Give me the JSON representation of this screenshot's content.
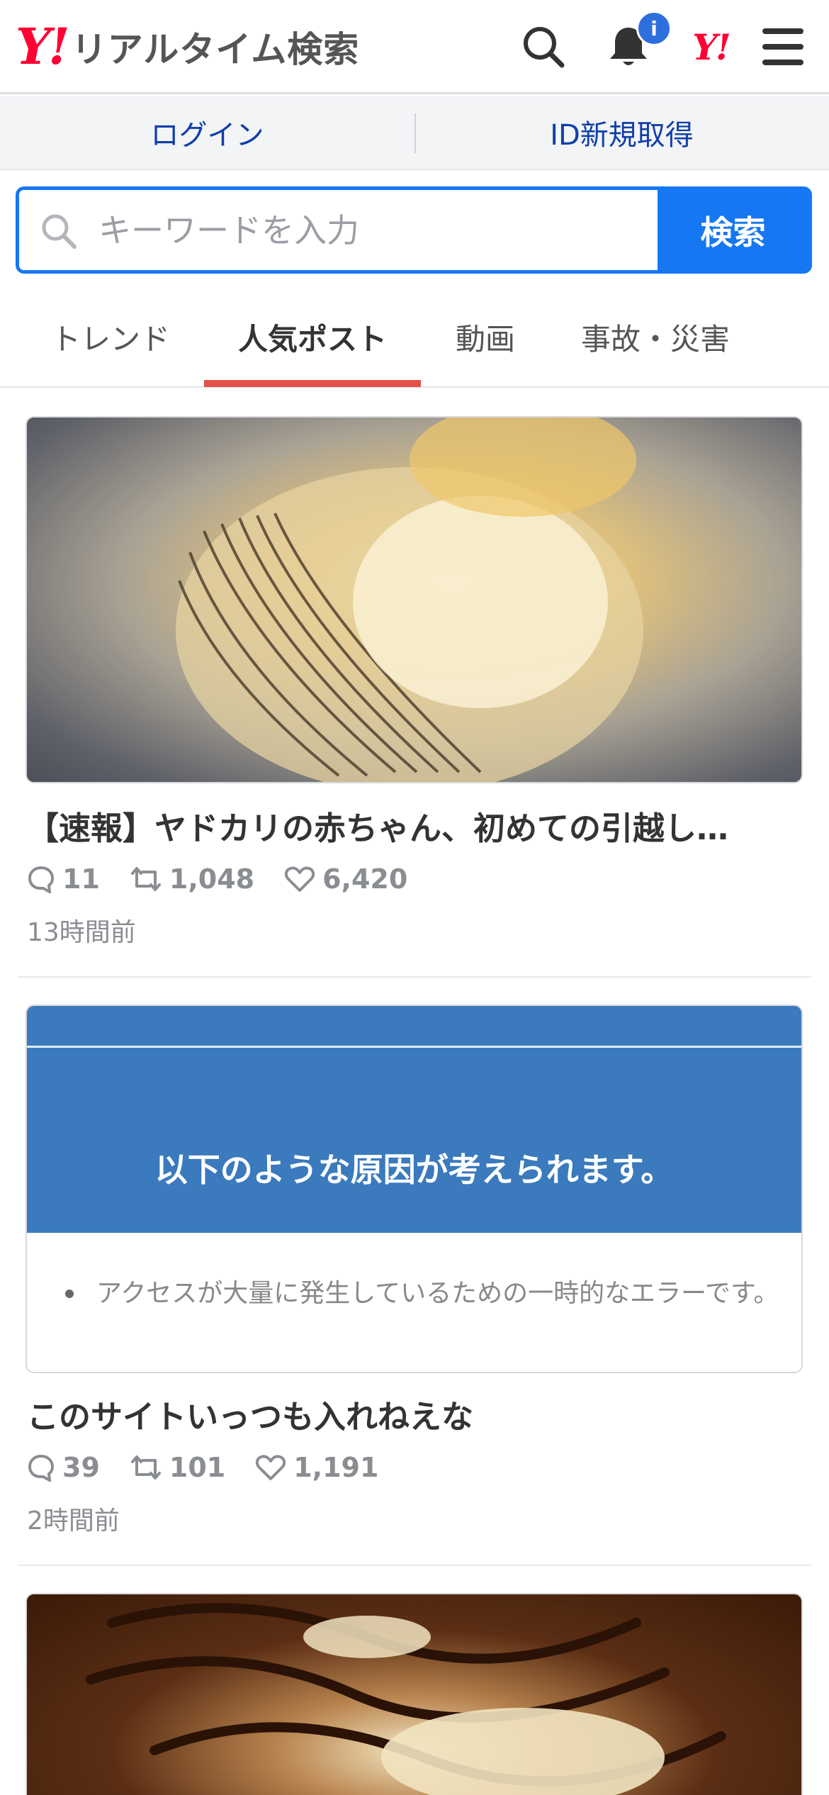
{
  "header": {
    "logo_mark": "Y!",
    "logo_title": "リアルタイム検索",
    "notification_badge": "i",
    "yahoo_logo": "Y!",
    "icons": [
      "search-icon",
      "bell-icon",
      "yahoo-japan-logo",
      "menu-icon"
    ]
  },
  "auth": {
    "login": "ログイン",
    "signup": "ID新規取得"
  },
  "search": {
    "placeholder": "キーワードを入力",
    "button": "検索"
  },
  "tabs": [
    {
      "label": "トレンド",
      "active": false
    },
    {
      "label": "人気ポスト",
      "active": true
    },
    {
      "label": "動画",
      "active": false
    },
    {
      "label": "事故・災害",
      "active": false
    }
  ],
  "colors": {
    "accent_blue": "#1677f2",
    "link_blue": "#1040a8",
    "brand_red": "#ff0033",
    "tab_underline": "#e3514a"
  },
  "posts": [
    {
      "title": "【速報】ヤドカリの赤ちゃん、初めての引越し…",
      "replies": "11",
      "reposts": "1,048",
      "likes": "6,420",
      "time": "13時間前"
    },
    {
      "media_heading": "以下のような原因が考えられます。",
      "media_bullet": "アクセスが大量に発生しているための一時的なエラーです。",
      "title": "このサイトいっつも入れねえな",
      "replies": "39",
      "reposts": "101",
      "likes": "1,191",
      "time": "2時間前"
    }
  ]
}
